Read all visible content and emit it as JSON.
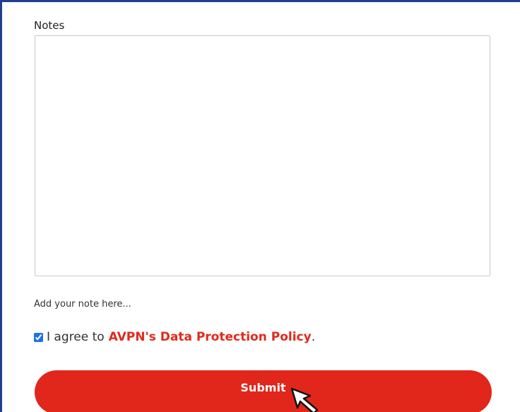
{
  "form": {
    "notes_label": "Notes",
    "notes_value": "",
    "helper_text": "Add your note here...",
    "consent": {
      "checked": true,
      "prefix": "I agree to",
      "link_text": "AVPN's Data Protection Policy",
      "suffix": "."
    },
    "submit_label": "Submit"
  },
  "colors": {
    "frame_border": "#1f3f8f",
    "accent_red": "#e1261c",
    "link_red": "#e02a1c"
  },
  "icons": {
    "cursor": "mouse-pointer-arrow"
  }
}
